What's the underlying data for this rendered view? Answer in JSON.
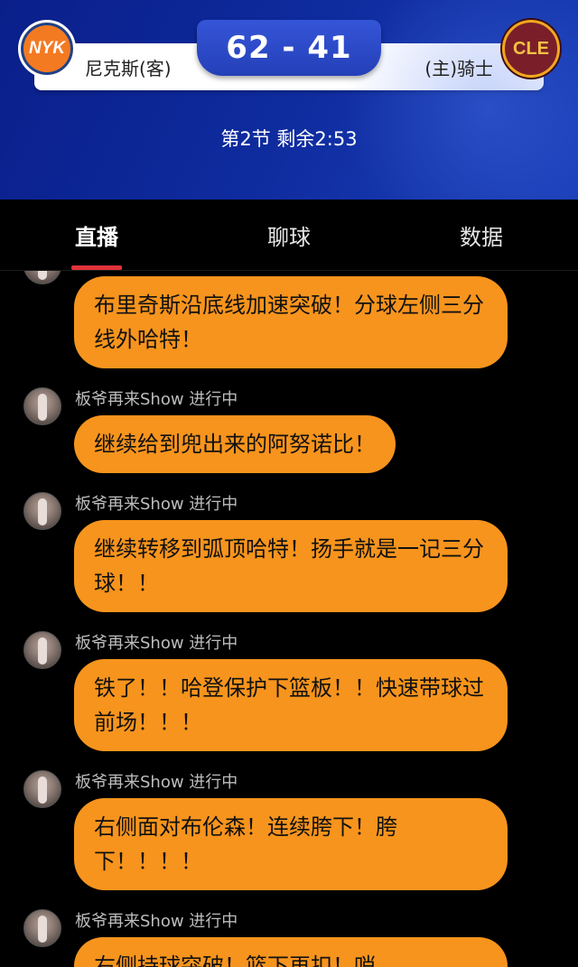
{
  "header": {
    "away_logo": "NYK",
    "home_logo": "CLE",
    "away_name": "尼克斯(客)",
    "home_name": "(主)骑士",
    "score": "62 - 41",
    "period": "第2节 剩余2:53",
    "away_color": "#f47a22",
    "home_color": "#7a1f2a"
  },
  "tabs": [
    "直播",
    "聊球",
    "数据"
  ],
  "tab_indicator_color": "#e0333a",
  "feed": {
    "bubble_color": "#f7941d",
    "messages": [
      {
        "user": "",
        "text": "布里奇斯沿底线加速突破！分球左侧三分线外哈特！"
      },
      {
        "user": "板爷再来Show 进行中",
        "text": "继续给到兜出来的阿努诺比！"
      },
      {
        "user": "板爷再来Show 进行中",
        "text": "继续转移到弧顶哈特！扬手就是一记三分球！！"
      },
      {
        "user": "板爷再来Show 进行中",
        "text": "铁了！！哈登保护下篮板！！快速带球过前场！！！"
      },
      {
        "user": "板爷再来Show 进行中",
        "text": "右侧面对布伦森！连续胯下！胯下！！！！"
      },
      {
        "user": "板爷再来Show 进行中",
        "text": "右侧持球突破！篮下再扣！哨"
      }
    ]
  }
}
